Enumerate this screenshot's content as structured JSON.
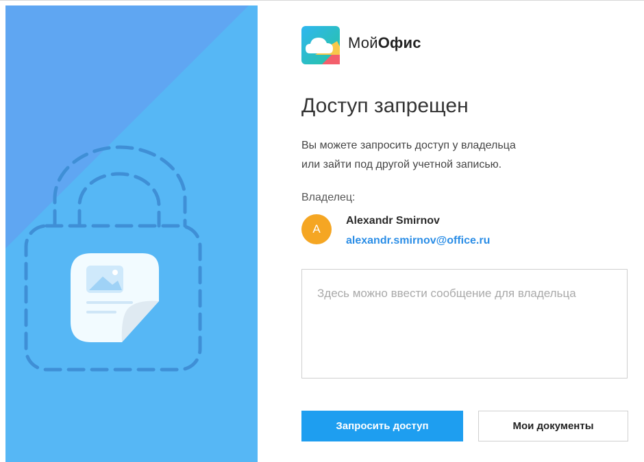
{
  "brand": {
    "prefix": "Мой",
    "bold": "Офис",
    "logo_icon": "cloud-logo-icon"
  },
  "illustration": {
    "lock_icon": "dashed-lock-icon",
    "document_icon": "image-document-icon"
  },
  "dialog": {
    "title": "Доступ запрещен",
    "description_line1": "Вы можете запросить доступ у владельца",
    "description_line2": "или зайти под другой учетной записью.",
    "owner_label": "Владелец:"
  },
  "owner": {
    "avatar_initial": "A",
    "name": "Alexandr Smirnov",
    "email": "alexandr.smirnov@office.ru"
  },
  "message": {
    "placeholder": "Здесь можно ввести сообщение для владельца",
    "value": ""
  },
  "buttons": {
    "request": "Запросить доступ",
    "my_documents": "Мои документы"
  },
  "colors": {
    "panel_light": "#56b7f5",
    "panel_dark": "#4aa9ef",
    "primary_button": "#1e9ef0",
    "link": "#2a8de6",
    "avatar": "#f5a623"
  }
}
